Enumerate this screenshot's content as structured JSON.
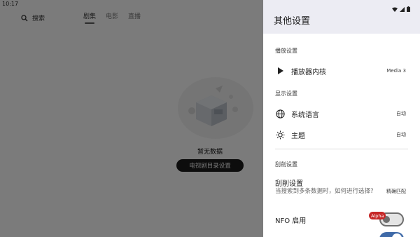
{
  "status_bar": {
    "time": "10:17",
    "icons": [
      "wifi-icon",
      "signal-icon",
      "battery-icon"
    ]
  },
  "app": {
    "search": {
      "label": "搜索",
      "icon": "search-icon"
    },
    "tabs": [
      {
        "label": "剧集",
        "active": true
      },
      {
        "label": "电影",
        "active": false
      },
      {
        "label": "直播",
        "active": false
      }
    ],
    "empty": {
      "title": "暂无数据",
      "button_label": "电视剧目录设置"
    }
  },
  "drawer": {
    "title": "其他设置",
    "sections": {
      "playback": "播放设置",
      "display": "显示设置",
      "scraping": "刮削设置"
    },
    "items": {
      "player_core": {
        "label": "播放器内核",
        "value": "Media 3",
        "icon": "play-icon"
      },
      "language": {
        "label": "系统语言",
        "value": "自动",
        "icon": "globe-icon"
      },
      "theme": {
        "label": "主题",
        "value": "自动",
        "icon": "sun-icon"
      },
      "scraping": {
        "label": "刮削设置",
        "description": "当搜索到多条数据时，如何进行选择?",
        "value": "精确匹配"
      },
      "nfo": {
        "label": "NFO 启用",
        "badge": "Alpha",
        "enabled": false
      }
    }
  },
  "colors": {
    "accent": "#3f6aa8",
    "badge": "#c62828",
    "header": "#ececf3"
  }
}
